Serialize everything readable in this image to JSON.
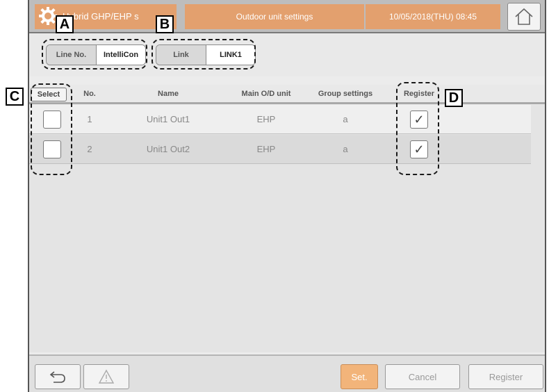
{
  "header": {
    "app_title": "Hybrid GHP/EHP s",
    "screen_title": "Outdoor unit settings",
    "datetime": "10/05/2018(THU) 08:45"
  },
  "tabs": {
    "line_group": {
      "options": [
        "Line No.",
        "IntelliCon"
      ],
      "selected": "IntelliCon"
    },
    "link_group": {
      "options": [
        "Link",
        "LINK1"
      ],
      "selected": "LINK1"
    }
  },
  "table": {
    "select_button": "Select",
    "columns": [
      "No.",
      "Name",
      "Main O/D unit",
      "Group settings",
      "Register"
    ],
    "rows": [
      {
        "no": "1",
        "name": "Unit1 Out1",
        "main_od_unit": "EHP",
        "group_setting": "a",
        "selected": false,
        "registered": true
      },
      {
        "no": "2",
        "name": "Unit1 Out2",
        "main_od_unit": "EHP",
        "group_setting": "a",
        "selected": false,
        "registered": true
      }
    ]
  },
  "footer": {
    "set_label": "Set.",
    "cancel_label": "Cancel",
    "register_label": "Register"
  },
  "callouts": [
    "A",
    "B",
    "C",
    "D"
  ],
  "icons": [
    "gear-icon",
    "home-icon",
    "back-arrow-icon",
    "warning-icon",
    "checkmark-icon"
  ],
  "colors": {
    "header_accent": "#e3a06e",
    "set_button": "#f2b47a"
  }
}
